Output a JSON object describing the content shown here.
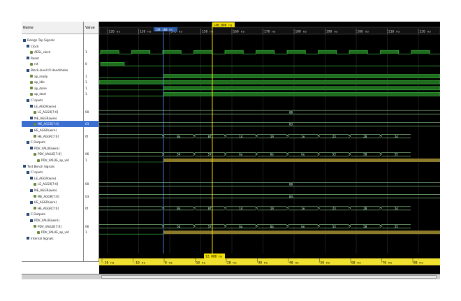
{
  "panel": {
    "name_header": "Name",
    "value_header": "Value"
  },
  "cursors": {
    "main_label": "140.000 ns",
    "secondary_label": "138.100 ns",
    "bottom_label": "12.000 ns"
  },
  "top_ticks": [
    "120 ns",
    "130 ns",
    "140 ns",
    "150 ns",
    "160 ns",
    "170 ns",
    "180 ns",
    "190 ns",
    "200 ns",
    "210 ns",
    "220 ns"
  ],
  "bottom_ticks": [
    "-20 ns",
    "-10 ns",
    "0 ns",
    "10 ns",
    "20 ns",
    "30 ns",
    "40 ns",
    "50 ns",
    "60 ns",
    "70 ns",
    "80 ns"
  ],
  "signals": [
    {
      "label": "Design Top Signals",
      "level": 0,
      "kind": "group",
      "value": ""
    },
    {
      "label": "Clock",
      "level": 1,
      "kind": "group",
      "value": ""
    },
    {
      "label": "AESL_clock",
      "level": 2,
      "kind": "bit",
      "value": "1",
      "wave": "clock"
    },
    {
      "label": "Reset",
      "level": 1,
      "kind": "group",
      "value": ""
    },
    {
      "label": "rst",
      "level": 2,
      "kind": "bit",
      "value": "0",
      "wave": "reset"
    },
    {
      "label": "Block-level IO Handshake",
      "level": 1,
      "kind": "group",
      "value": ""
    },
    {
      "label": "ap_ready",
      "level": 2,
      "kind": "bit",
      "value": "1",
      "wave": "high_after"
    },
    {
      "label": "ap_idle",
      "level": 2,
      "kind": "bit",
      "value": "1",
      "wave": "high"
    },
    {
      "label": "ap_done",
      "level": 2,
      "kind": "bit",
      "value": "1",
      "wave": "high_after"
    },
    {
      "label": "ap_start",
      "level": 2,
      "kind": "bit",
      "value": "1",
      "wave": "high_after"
    },
    {
      "label": "C Inputs",
      "level": 1,
      "kind": "group",
      "value": ""
    },
    {
      "label": "LE_AGGR(wire)",
      "level": 2,
      "kind": "group",
      "value": ""
    },
    {
      "label": "LE_AGGR[7:0]",
      "level": 3,
      "kind": "bus",
      "value": "00",
      "wave": "const",
      "text": "00"
    },
    {
      "label": "ME_AGGR(wire)",
      "level": 2,
      "kind": "group",
      "value": ""
    },
    {
      "label": "ME_AGGR[7:0]",
      "level": 3,
      "kind": "bus",
      "value": "03",
      "wave": "const",
      "text": "03",
      "selected": true
    },
    {
      "label": "HE_AGGR(wire)",
      "level": 2,
      "kind": "group",
      "value": ""
    },
    {
      "label": "HE_AGGR[7:0]",
      "level": 3,
      "kind": "bus",
      "value": "0f",
      "wave": "bus",
      "texts": [
        "0a",
        "0f",
        "14",
        "19",
        "1e",
        "23",
        "28",
        "2d"
      ]
    },
    {
      "label": "C Outputs",
      "level": 1,
      "kind": "group",
      "value": ""
    },
    {
      "label": "PDV_VALUE(wire)",
      "level": 2,
      "kind": "group",
      "value": ""
    },
    {
      "label": "PDV_VALUE[7:0]",
      "level": 3,
      "kind": "bus",
      "value": "06",
      "wave": "bus",
      "texts": [
        "54",
        "5f",
        "6a",
        "6b",
        "6e",
        "53",
        "50",
        "55"
      ]
    },
    {
      "label": "PDV_VALUE_ap_vld",
      "level": 4,
      "kind": "bit",
      "value": "1",
      "wave": "vld"
    },
    {
      "label": "Test Bench Signals",
      "level": 0,
      "kind": "group",
      "value": ""
    },
    {
      "label": "C Inputs",
      "level": 1,
      "kind": "group",
      "value": ""
    },
    {
      "label": "LE_AGGR(wire)",
      "level": 2,
      "kind": "group",
      "value": ""
    },
    {
      "label": "LE_AGGR[7:0]",
      "level": 3,
      "kind": "bus",
      "value": "00",
      "wave": "const",
      "text": "00"
    },
    {
      "label": "ME_AGGR(wire)",
      "level": 2,
      "kind": "group",
      "value": ""
    },
    {
      "label": "ME_AGGR[7:0]",
      "level": 3,
      "kind": "bus",
      "value": "03",
      "wave": "const",
      "text": "03"
    },
    {
      "label": "HE_AGGR(wire)",
      "level": 2,
      "kind": "group",
      "value": ""
    },
    {
      "label": "HE_AGGR[7:0]",
      "level": 3,
      "kind": "bus",
      "value": "0f",
      "wave": "bus",
      "texts": [
        "0a",
        "0f",
        "14",
        "19",
        "1e",
        "23",
        "28",
        "2d"
      ]
    },
    {
      "label": "C Outputs",
      "level": 1,
      "kind": "group",
      "value": ""
    },
    {
      "label": "PDV_VALUE(wire)",
      "level": 2,
      "kind": "group",
      "value": ""
    },
    {
      "label": "PDV_VALUE[7:0]",
      "level": 3,
      "kind": "bus",
      "value": "06",
      "wave": "bus",
      "texts": [
        "54",
        "5f",
        "6a",
        "6b",
        "6e",
        "53",
        "50",
        "55"
      ]
    },
    {
      "label": "PDV_VALUE_ap_vld",
      "level": 4,
      "kind": "bit",
      "value": "1",
      "wave": "vld"
    },
    {
      "label": "Internal Signals",
      "level": 1,
      "kind": "group",
      "value": ""
    }
  ],
  "colors": {
    "wave": "#3ec43e",
    "wave_fill": "#1f6b1f",
    "bus": "#8fd78f",
    "vld": "#8a7a2a",
    "cursor_main": "#f5e000",
    "cursor_sec": "#5aa0ff",
    "ruler_top": "#111111",
    "ruler_bottom": "#f0e030",
    "grid": "#3a3a3a"
  }
}
